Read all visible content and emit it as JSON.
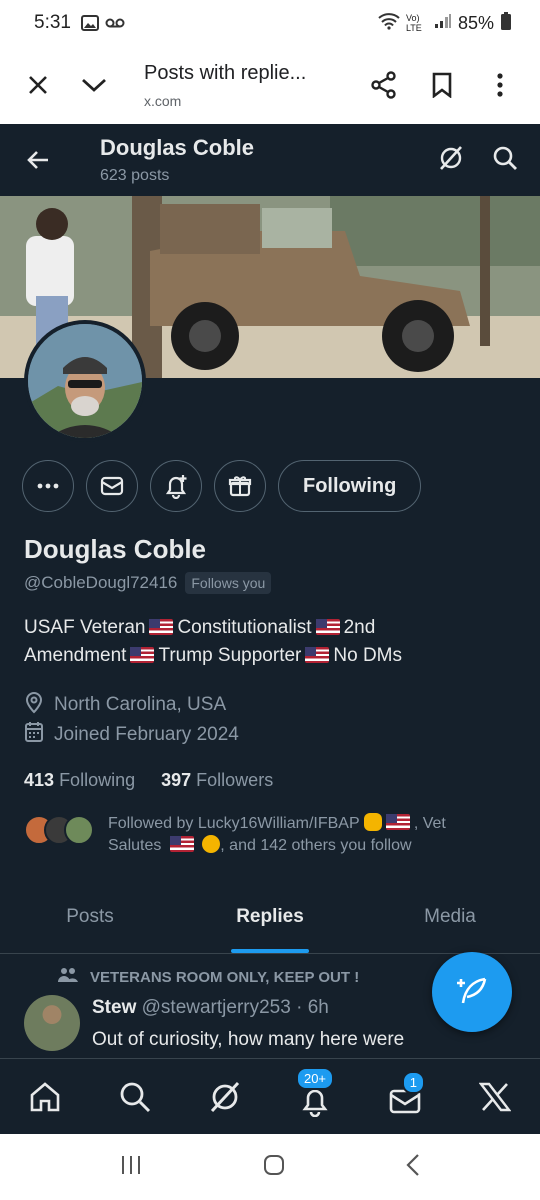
{
  "status_bar": {
    "time": "5:31",
    "battery": "85%",
    "network": "Vo) LTE"
  },
  "browser": {
    "title": "Posts with replie...",
    "url": "x.com"
  },
  "profile_header": {
    "name": "Douglas Coble",
    "post_count": "623 posts"
  },
  "profile": {
    "display_name": "Douglas Coble",
    "handle": "@CobleDougl72416",
    "follows_you": "Follows you",
    "following_button": "Following",
    "bio_parts": [
      "USAF Veteran",
      "Constitutionalist",
      "2nd",
      "Amendment",
      "Trump Supporter",
      "No DMs"
    ],
    "location": "North Carolina, USA",
    "joined": "Joined February 2024",
    "following_count": "413",
    "following_label": "Following",
    "followers_count": "397",
    "followers_label": "Followers",
    "followed_by_a": "Followed by Lucky16William/IFBAP",
    "followed_by_b": ", Vet",
    "followed_by_c": "Salutes",
    "followed_by_d": ", and 142 others you follow"
  },
  "tabs": [
    "Posts",
    "Replies",
    "Media"
  ],
  "tweet": {
    "community": "VETERANS ROOM ONLY, KEEP OUT !",
    "author": "Stew",
    "handle": "@stewartjerry253",
    "time": "· 6h",
    "text": "Out of curiosity, how many here were"
  },
  "bottom_nav": {
    "notifications_badge": "20+",
    "messages_badge": "1"
  },
  "colors": {
    "background": "#15202b",
    "accent": "#1d9bf0",
    "muted": "#8b98a5"
  }
}
